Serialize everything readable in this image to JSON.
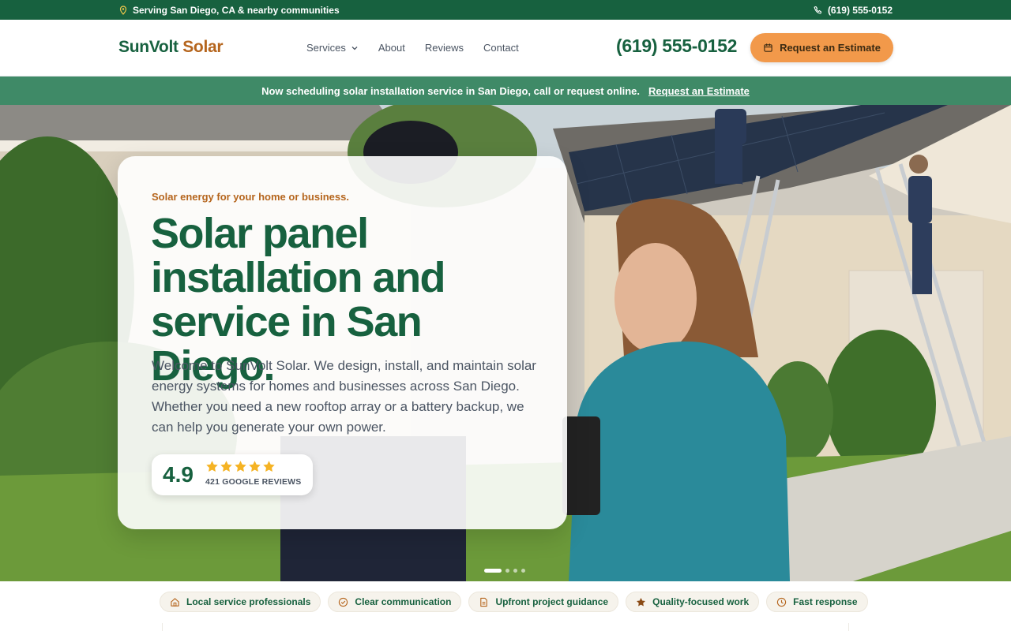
{
  "topbar": {
    "location": "Serving San Diego, CA & nearby communities",
    "phone": "(619) 555-0152",
    "icons": [
      "map-pin-icon",
      "phone-icon"
    ]
  },
  "header": {
    "logo_part1": "SunVolt",
    "logo_part2": "Solar",
    "nav": {
      "services": "Services",
      "about": "About",
      "reviews": "Reviews",
      "contact": "Contact"
    },
    "phone": "(619) 555-0152",
    "cta": "Request an Estimate"
  },
  "announcement": {
    "text": "Now scheduling solar installation service in San Diego, call or request online.",
    "link": "Request an Estimate"
  },
  "hero": {
    "eyebrow": "Solar energy for your home or business.",
    "headline": "Solar panel installation and service in San Diego.",
    "body": "Welcome to SunVolt Solar. We design, install, and maintain solar energy systems for homes and businesses across San Diego. Whether you need a new rooftop array or a battery backup, we can help you generate your own power.",
    "rating": {
      "score": "4.9",
      "stars": 5,
      "count": "421 GOOGLE REVIEWS"
    },
    "slides": {
      "count": 4,
      "active": 1
    }
  },
  "trust_chips": [
    {
      "label": "Local service professionals",
      "icon": "home-icon"
    },
    {
      "label": "Clear communication",
      "icon": "check-circle-icon"
    },
    {
      "label": "Upfront project guidance",
      "icon": "document-icon"
    },
    {
      "label": "Quality-focused work",
      "icon": "star-icon"
    },
    {
      "label": "Fast response",
      "icon": "clock-icon"
    }
  ],
  "colors": {
    "brand_green": "#17613f",
    "announce_green": "#3f8a67",
    "accent_orange": "#f2994a",
    "accent_brown": "#b5651d",
    "star_gold": "#f5b324"
  }
}
